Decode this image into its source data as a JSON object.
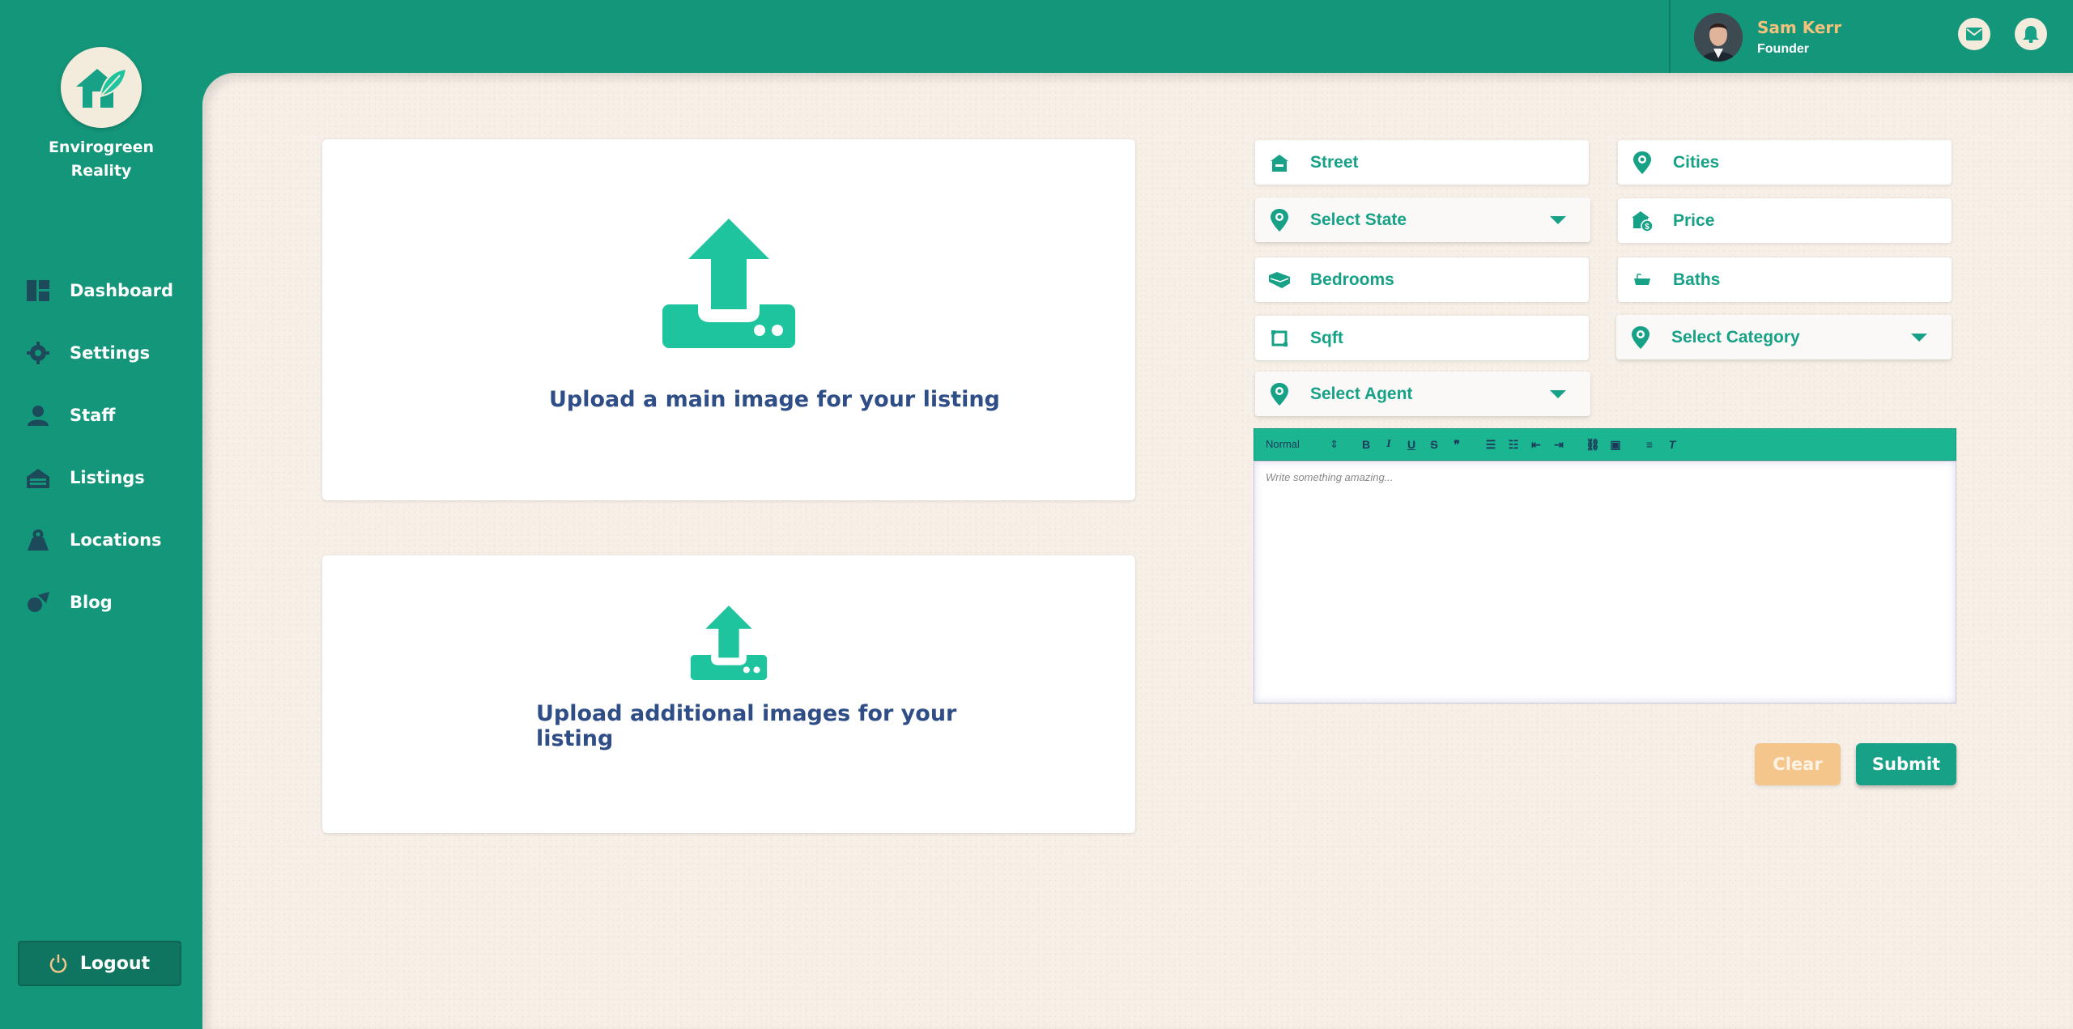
{
  "brand": {
    "name_line1": "Envirogreen",
    "name_line2": "Reality"
  },
  "sidebar": {
    "items": [
      {
        "label": "Dashboard",
        "icon": "dashboard-icon"
      },
      {
        "label": "Settings",
        "icon": "gear-icon"
      },
      {
        "label": "Staff",
        "icon": "user-icon"
      },
      {
        "label": "Listings",
        "icon": "listings-icon"
      },
      {
        "label": "Locations",
        "icon": "location-icon"
      },
      {
        "label": "Blog",
        "icon": "blog-icon"
      }
    ],
    "logout_label": "Logout"
  },
  "user": {
    "name": "Sam Kerr",
    "role": "Founder"
  },
  "uploads": {
    "main_text": "Upload a main image for your listing",
    "extra_text_line1": "Upload additional images for your",
    "extra_text_line2": "listing"
  },
  "form": {
    "street": "Street",
    "cities": "Cities",
    "state": "Select State",
    "price": "Price",
    "bedrooms": "Bedrooms",
    "baths": "Baths",
    "sqft": "Sqft",
    "category": "Select Category",
    "agent": "Select Agent"
  },
  "editor": {
    "format_value": "Normal",
    "placeholder": "Write something amazing..."
  },
  "actions": {
    "clear": "Clear",
    "submit": "Submit"
  },
  "colors": {
    "brand_green": "#14967a",
    "accent_green": "#1ec49d",
    "text_blue": "#2f4d86",
    "clear_button": "#f5c68c",
    "name_gold": "#f2c27d"
  }
}
